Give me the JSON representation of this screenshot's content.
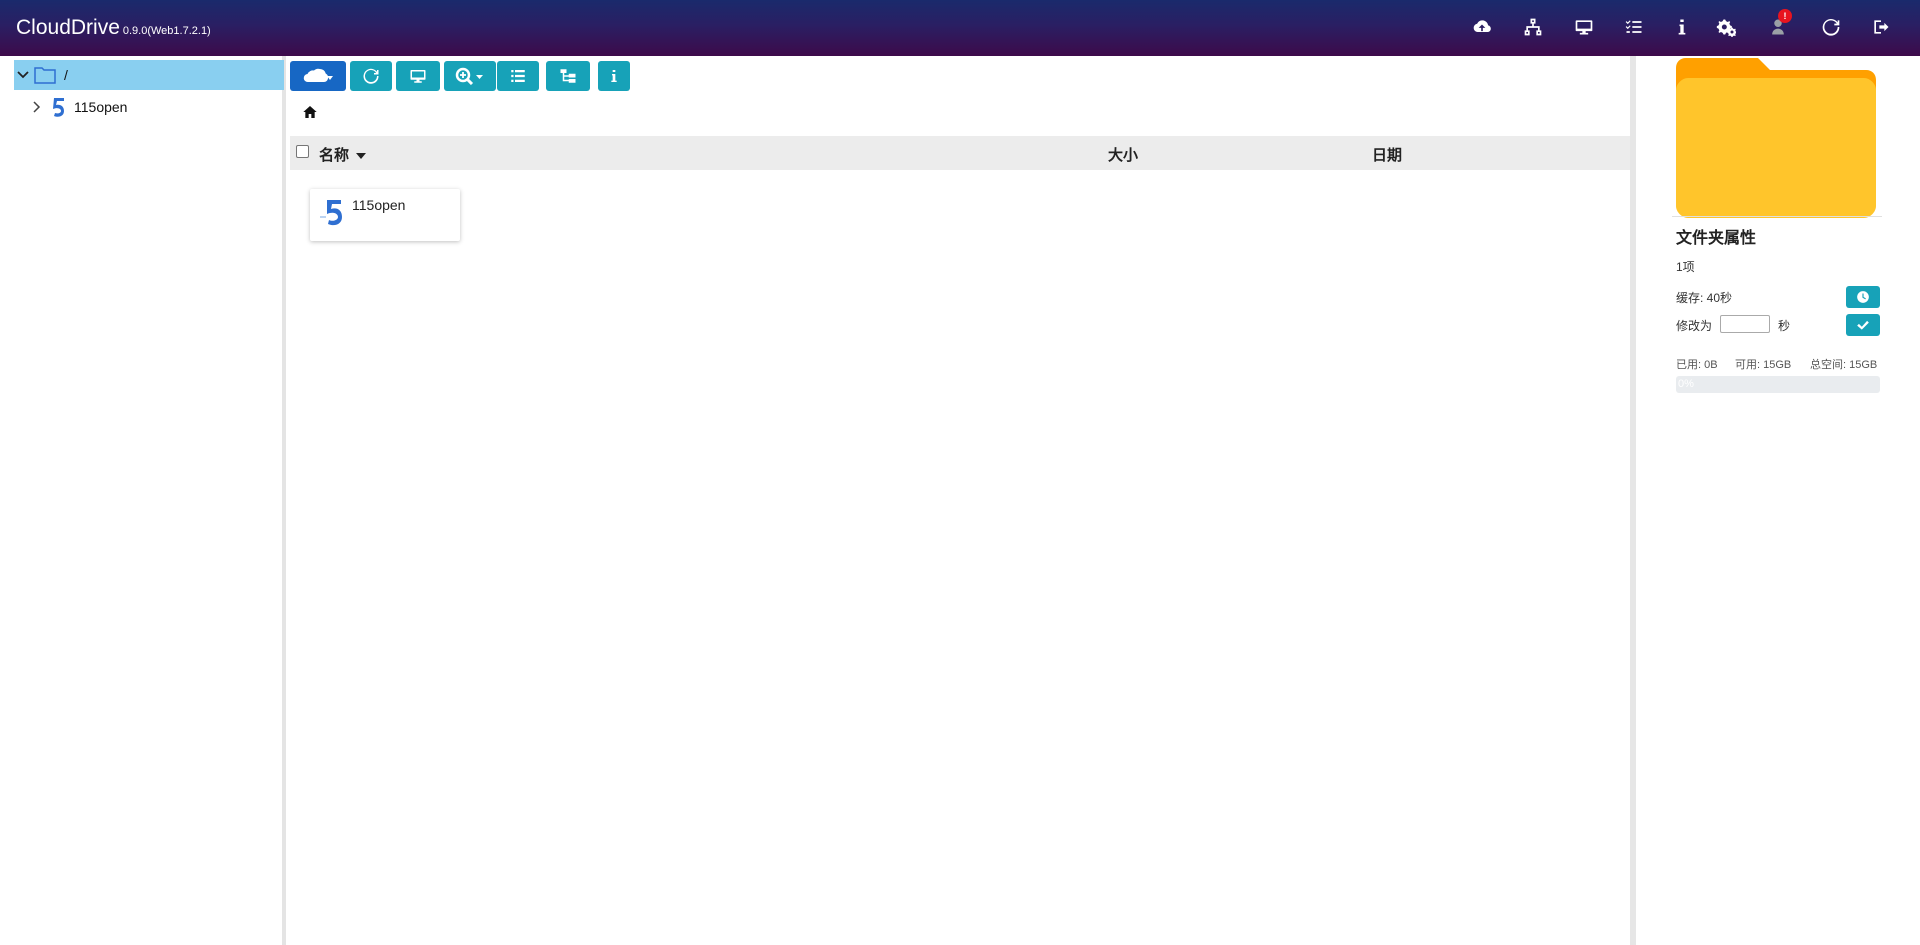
{
  "header": {
    "app_name": "CloudDrive",
    "version": "0.9.0(Web1.7.2.1)",
    "gradient": [
      "#1a2a6c",
      "#3d0a4a"
    ],
    "icons": [
      "cloud-upload-icon",
      "network-icon",
      "monitor-icon",
      "task-list-icon",
      "info-icon",
      "settings-icon",
      "user-icon",
      "refresh-icon",
      "logout-icon"
    ],
    "notification_badge": "!"
  },
  "tree": {
    "root_label": "/",
    "items": [
      {
        "label": "115open",
        "icon": "115-logo-icon"
      }
    ],
    "selected_color": "#89cff0"
  },
  "toolbar": {
    "buttons": [
      "cloud-menu",
      "refresh",
      "mount",
      "search-menu",
      "list-view",
      "tree-view",
      "info"
    ],
    "accent": "#17a2b8",
    "primary": "#1767c4"
  },
  "table": {
    "columns": {
      "name": "名称",
      "size": "大小",
      "date": "日期"
    },
    "rows": [
      {
        "name": "115open",
        "icon": "115-logo-icon"
      }
    ]
  },
  "properties": {
    "title": "文件夹属性",
    "item_count": "1项",
    "cache_label": "缓存: 40秒",
    "modify_label": "修改为",
    "modify_input_value": "",
    "seconds_unit": "秒",
    "used": "已用: 0B",
    "available": "可用: 15GB",
    "total": "总空间: 15GB",
    "usage_fraction": 0,
    "usage_text": "0%",
    "folder_color": "#ffc52b"
  }
}
